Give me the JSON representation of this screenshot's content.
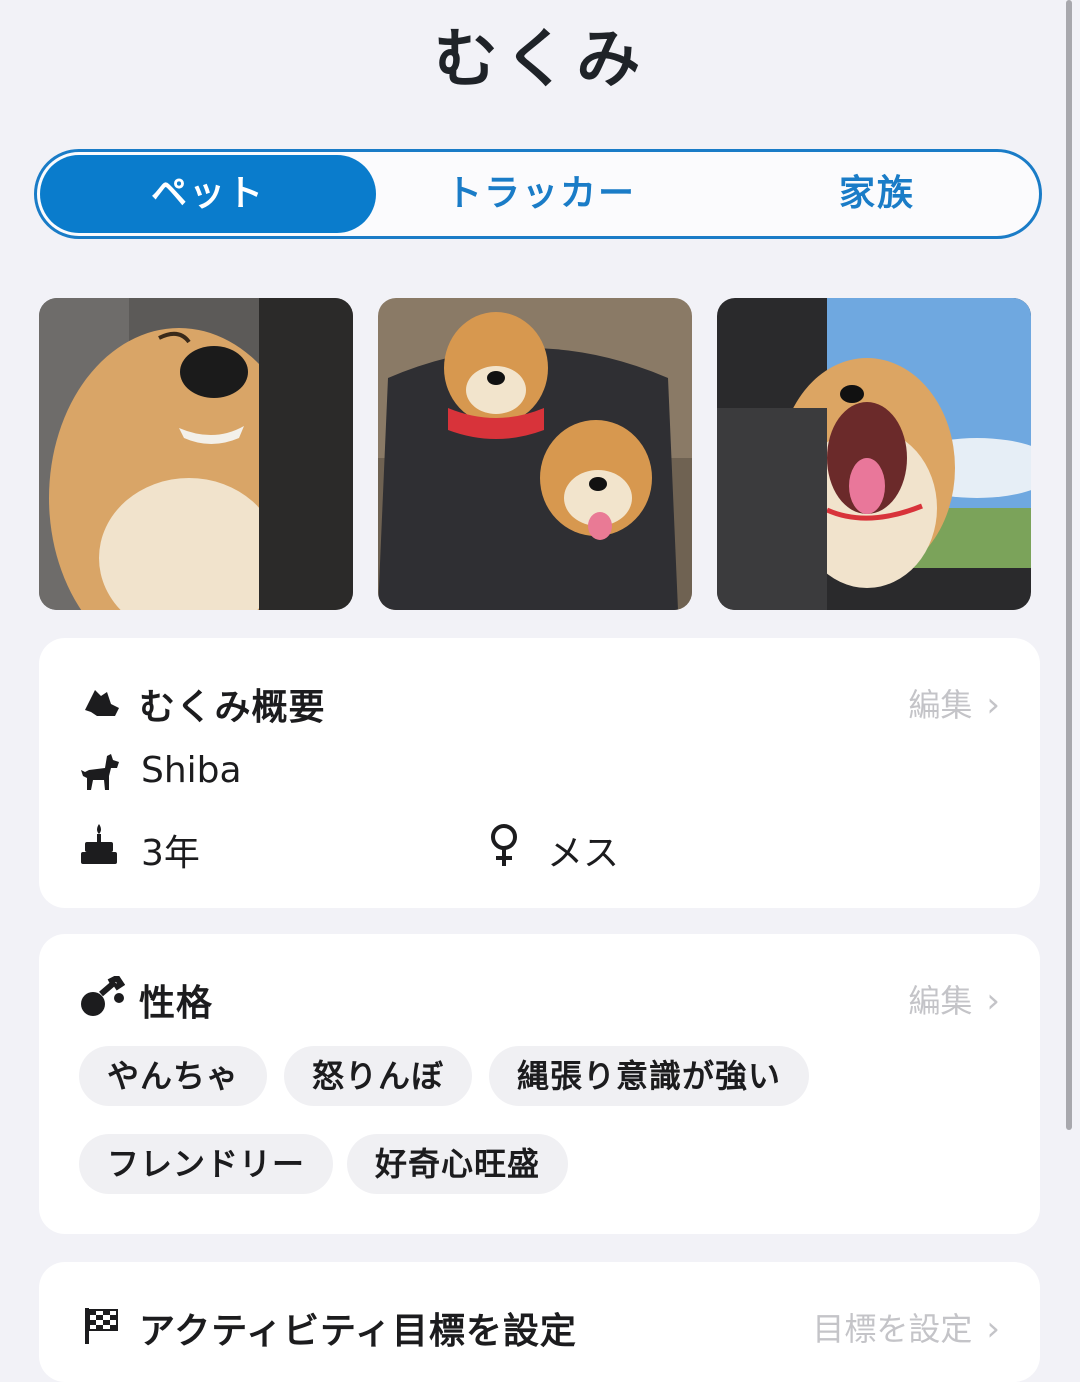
{
  "header": {
    "title": "むくみ"
  },
  "tabs": [
    {
      "label": "ペット",
      "active": true
    },
    {
      "label": "トラッカー",
      "active": false
    },
    {
      "label": "家族",
      "active": false
    }
  ],
  "photos": [
    {
      "alt": "sleepy-shiba-closeup"
    },
    {
      "alt": "two-shibas-in-stroller"
    },
    {
      "alt": "shiba-yawning-in-car"
    }
  ],
  "overview": {
    "title": "むくみ概要",
    "edit_label": "編集",
    "breed": "Shiba",
    "age": "3年",
    "sex": "メス"
  },
  "personality": {
    "title": "性格",
    "edit_label": "編集",
    "traits": [
      "やんちゃ",
      "怒りんぼ",
      "縄張り意識が強い",
      "フレンドリー",
      "好奇心旺盛"
    ]
  },
  "activity": {
    "title": "アクティビティ目標を設定",
    "action_label": "目標を設定"
  },
  "colors": {
    "accent": "#0a7ccc",
    "background": "#f2f2f7",
    "card": "#ffffff",
    "muted": "#c4c4c8"
  }
}
